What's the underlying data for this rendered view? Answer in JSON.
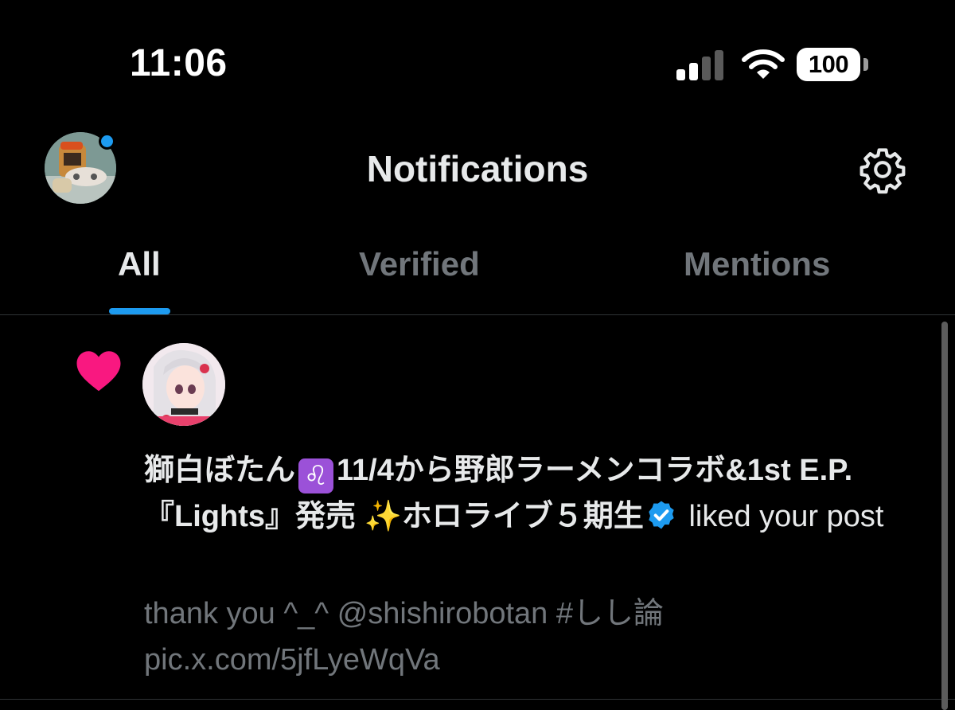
{
  "status_bar": {
    "time": "11:06",
    "battery": "100",
    "icons": [
      "cellular-signal-icon",
      "wifi-icon",
      "battery-icon"
    ]
  },
  "header": {
    "title": "Notifications",
    "settings_icon": "gear-icon",
    "has_unread_dot": true
  },
  "tabs": [
    {
      "label": "All",
      "active": true
    },
    {
      "label": "Verified",
      "active": false
    },
    {
      "label": "Mentions",
      "active": false
    }
  ],
  "notification": {
    "type_icon": "heart-icon",
    "name_part1": "獅白ぼたん",
    "name_emoji": "♌",
    "name_part2": "11/4から野郎ラーメンコラボ&1st E.P.『Lights』発売",
    "name_sparkle": "✨",
    "name_part3": "ホロライブ５期生",
    "action": "liked your post",
    "post_preview": "thank you ^_^ @shishirobotan #しし論 pic.x.com/5jfLyeWqVa"
  },
  "colors": {
    "background": "#000000",
    "accent": "#1d9bf0",
    "like": "#f91880",
    "text_primary": "#e7e9ea",
    "text_secondary": "#71767b"
  }
}
